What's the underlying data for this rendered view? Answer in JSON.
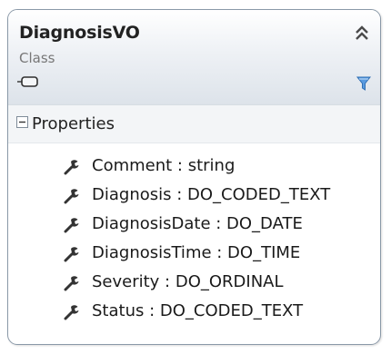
{
  "class": {
    "name": "DiagnosisVO",
    "stereotype": "Class"
  },
  "section": {
    "label": "Properties"
  },
  "properties": [
    {
      "text": "Comment : string"
    },
    {
      "text": "Diagnosis : DO_CODED_TEXT"
    },
    {
      "text": "DiagnosisDate : DO_DATE"
    },
    {
      "text": "DiagnosisTime : DO_TIME"
    },
    {
      "text": "Severity : DO_ORDINAL"
    },
    {
      "text": "Status : DO_CODED_TEXT"
    }
  ],
  "icons": {
    "collapse": "double-chevron-up-icon",
    "base_type": "class-shape-icon",
    "filter": "filter-funnel-icon",
    "expander": "minus-box-icon",
    "property": "wrench-icon"
  },
  "colors": {
    "border": "#8a99a8",
    "header_top": "#ffffff",
    "header_bottom": "#dde3ea",
    "section_bg": "#f3f5f7",
    "filter_accent": "#3b7ec8",
    "text": "#222222",
    "muted": "#777777"
  }
}
